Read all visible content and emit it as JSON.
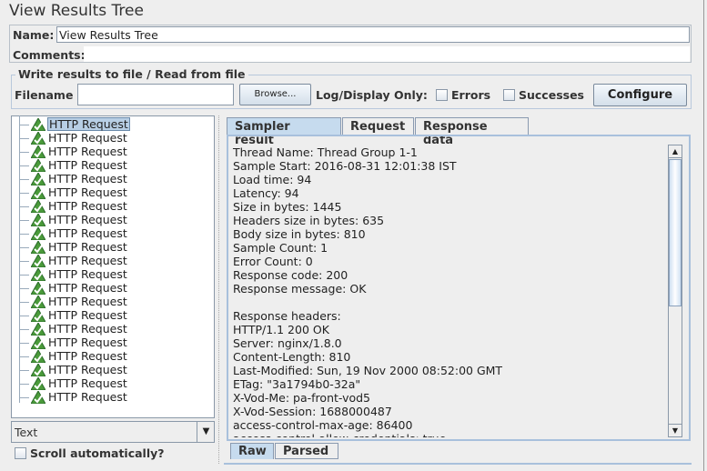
{
  "title": "View Results Tree",
  "name_label": "Name:",
  "name_value": "View Results Tree",
  "comments_label": "Comments:",
  "comments_value": "",
  "file_group_title": "Write results to file / Read from file",
  "filename_label": "Filename",
  "filename_value": "",
  "browse_label": "Browse...",
  "log_display_label": "Log/Display Only:",
  "errors_label": "Errors",
  "errors_checked": false,
  "successes_label": "Successes",
  "successes_checked": false,
  "configure_label": "Configure",
  "tree_items": [
    "HTTP Request",
    "HTTP Request",
    "HTTP Request",
    "HTTP Request",
    "HTTP Request",
    "HTTP Request",
    "HTTP Request",
    "HTTP Request",
    "HTTP Request",
    "HTTP Request",
    "HTTP Request",
    "HTTP Request",
    "HTTP Request",
    "HTTP Request",
    "HTTP Request",
    "HTTP Request",
    "HTTP Request",
    "HTTP Request",
    "HTTP Request",
    "HTTP Request",
    "HTTP Request"
  ],
  "tree_icon": "success-warning-triangle-icon",
  "renderer_select": "Text",
  "scroll_auto_label": "Scroll automatically?",
  "scroll_auto_checked": false,
  "tabs": [
    "Sampler result",
    "Request",
    "Response data"
  ],
  "bottom_tabs": [
    "Raw",
    "Parsed"
  ],
  "sampler_lines": [
    "Thread Name: Thread Group 1-1",
    "Sample Start: 2016-08-31 12:01:38 IST",
    "Load time: 94",
    "Latency: 94",
    "Size in bytes: 1445",
    "Headers size in bytes: 635",
    "Body size in bytes: 810",
    "Sample Count: 1",
    "Error Count: 0",
    "Response code: 200",
    "Response message: OK",
    "",
    "Response headers:",
    "HTTP/1.1 200 OK",
    "Server: nginx/1.8.0",
    "Content-Length: 810",
    "Last-Modified: Sun, 19 Nov 2000 08:52:00 GMT",
    "ETag: \"3a1794b0-32a\"",
    "X-Vod-Me: pa-front-vod5",
    "X-Vod-Session: 1688000487",
    "access-control-max-age: 86400",
    "access-control-allow-credentials: true"
  ]
}
